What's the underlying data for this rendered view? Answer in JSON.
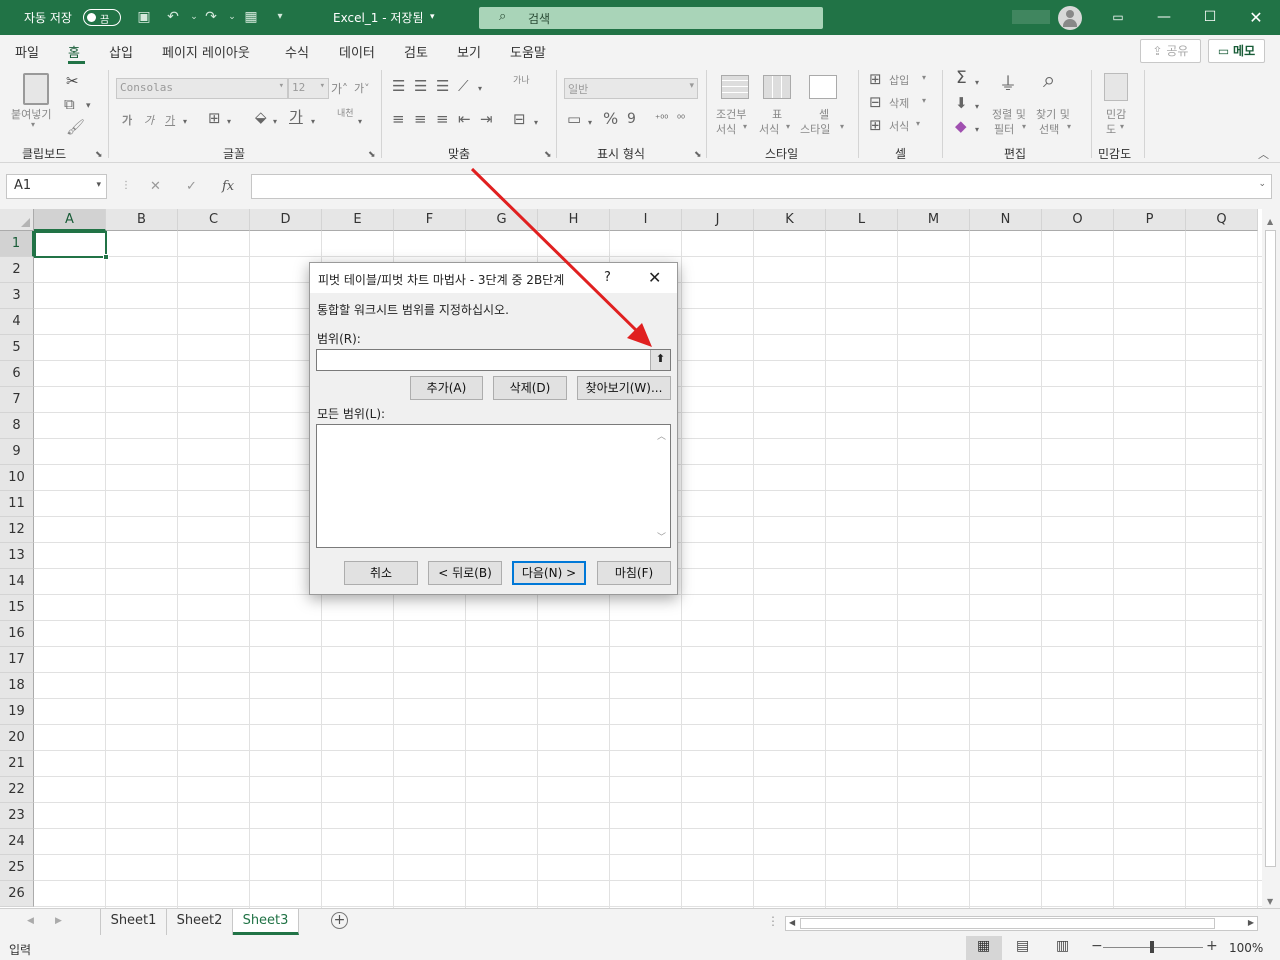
{
  "titlebar": {
    "autosave_label": "자동 저장",
    "autosave_state": "끔",
    "doc_title": "Excel_1 - 저장됨",
    "search_placeholder": "검색"
  },
  "tabs": [
    "파일",
    "홈",
    "삽입",
    "페이지 레이아웃",
    "수식",
    "데이터",
    "검토",
    "보기",
    "도움말"
  ],
  "share_label": "공유",
  "memo_label": "메모",
  "ribbon": {
    "clipboard": {
      "paste": "붙여넣기",
      "label": "클립보드"
    },
    "font": {
      "name": "Consolas",
      "size": "12",
      "label": "글꼴",
      "bold": "가",
      "italic": "가",
      "underline": "가",
      "grow": "가",
      "shrink": "가",
      "phonetic": "내천"
    },
    "alignment": {
      "label": "맞춤",
      "wrap": "가나"
    },
    "number": {
      "format": "일반",
      "label": "표시 형식"
    },
    "styles": {
      "conditional_1": "조건부",
      "conditional_2": "서식",
      "table_1": "표",
      "table_2": "서식",
      "cell_1": "셀",
      "cell_2": "스타일",
      "label": "스타일"
    },
    "cells": {
      "insert": "삽입",
      "delete": "삭제",
      "format": "서식",
      "label": "셀"
    },
    "editing": {
      "sort_1": "정렬 및",
      "sort_2": "필터",
      "find_1": "찾기 및",
      "find_2": "선택",
      "label": "편집"
    },
    "sensitivity": {
      "line1": "민감",
      "line2": "도",
      "label": "민감도"
    }
  },
  "namebox": "A1",
  "columns": [
    "A",
    "B",
    "C",
    "D",
    "E",
    "F",
    "G",
    "H",
    "I",
    "J",
    "K",
    "L",
    "M",
    "N",
    "O",
    "P",
    "Q"
  ],
  "rows": [
    "1",
    "2",
    "3",
    "4",
    "5",
    "6",
    "7",
    "8",
    "9",
    "10",
    "11",
    "12",
    "13",
    "14",
    "15",
    "16",
    "17",
    "18",
    "19",
    "20",
    "21",
    "22",
    "23",
    "24",
    "25",
    "26"
  ],
  "dialog": {
    "title": "피벗 테이블/피벗 차트 마법사 - 3단계 중 2B단계",
    "help": "?",
    "instruction": "통합할 워크시트 범위를 지정하십시오.",
    "range_label": "범위(R):",
    "range_value": "",
    "add": "추가(A)",
    "delete": "삭제(D)",
    "browse": "찾아보기(W)...",
    "all_ranges_label": "모든 범위(L):",
    "cancel": "취소",
    "back": "< 뒤로(B)",
    "next": "다음(N) >",
    "finish": "마침(F)"
  },
  "sheets": [
    "Sheet1",
    "Sheet2",
    "Sheet3"
  ],
  "active_sheet": "Sheet3",
  "status": {
    "mode": "입력",
    "zoom": "100%"
  },
  "colors": {
    "brand": "#217346",
    "annotation_arrow": "#e02020"
  }
}
